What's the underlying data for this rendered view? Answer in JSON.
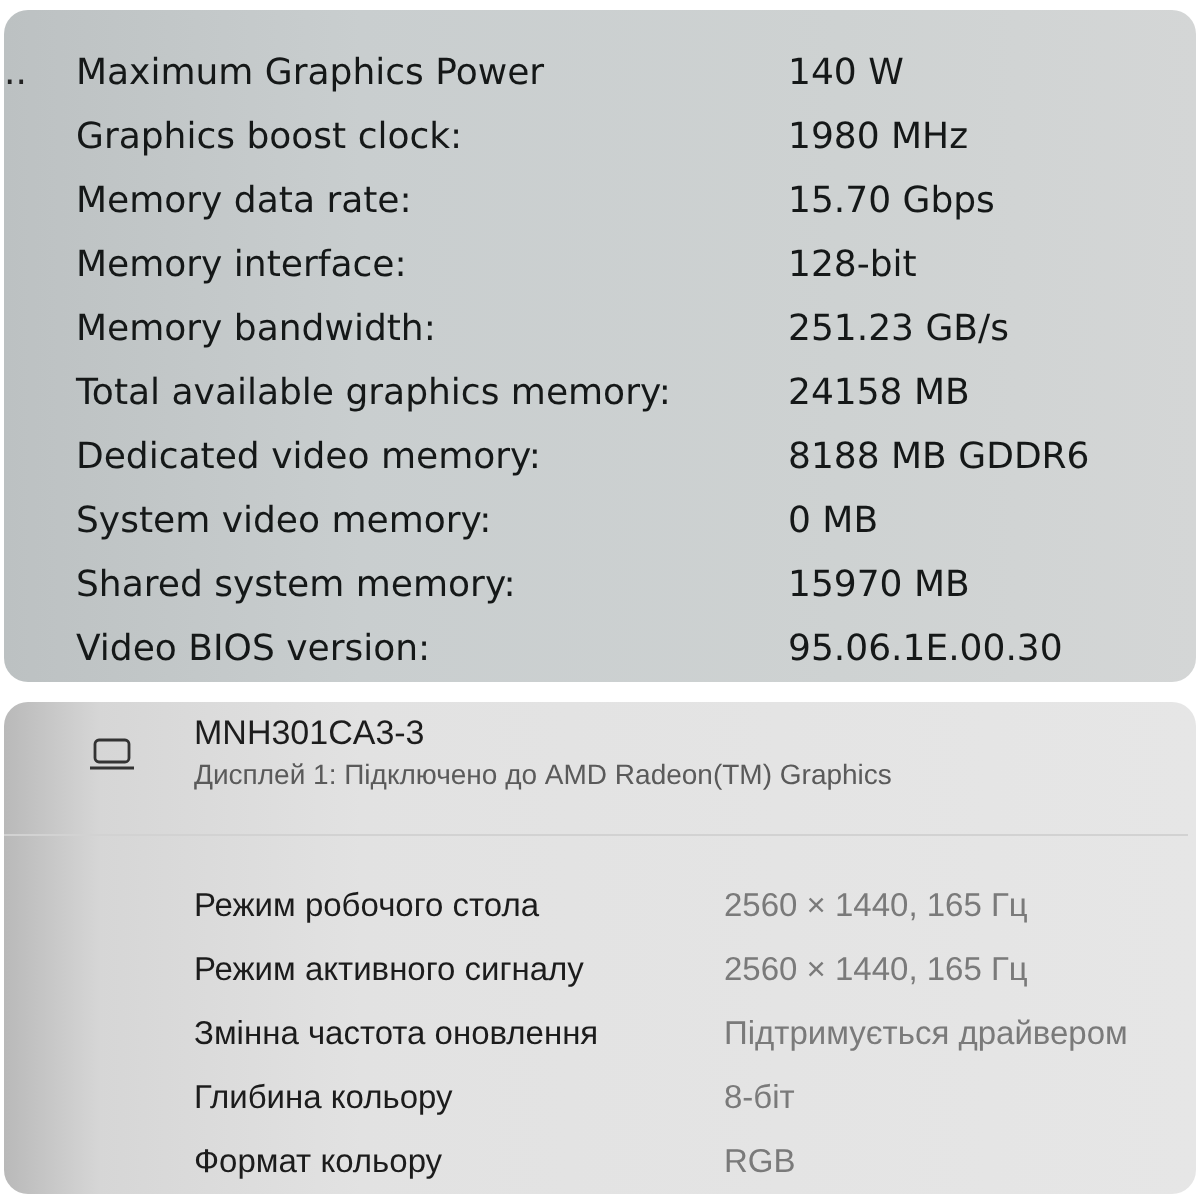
{
  "gpu_details": {
    "left_pane_fragment": "..",
    "properties": [
      {
        "label": "Maximum Graphics Power",
        "value": "140 W"
      },
      {
        "label": "Graphics boost clock:",
        "value": "1980 MHz"
      },
      {
        "label": "Memory data rate:",
        "value": "15.70 Gbps"
      },
      {
        "label": "Memory interface:",
        "value": "128-bit"
      },
      {
        "label": "Memory bandwidth:",
        "value": "251.23 GB/s"
      },
      {
        "label": "Total available graphics memory:",
        "value": "24158 MB"
      },
      {
        "label": "Dedicated video memory:",
        "value": "8188 MB GDDR6"
      },
      {
        "label": "System video memory:",
        "value": "0 MB"
      },
      {
        "label": "Shared system memory:",
        "value": "15970 MB"
      },
      {
        "label": "Video BIOS version:",
        "value": "95.06.1E.00.30"
      }
    ]
  },
  "display": {
    "name": "MNH301CA3-3",
    "connection": "Дисплей 1: Підключено до AMD Radeon(TM) Graphics",
    "properties": [
      {
        "label": "Режим робочого стола",
        "value": "2560 × 1440, 165 Гц"
      },
      {
        "label": "Режим активного сигналу",
        "value": "2560 × 1440, 165 Гц"
      },
      {
        "label": "Змінна частота оновлення",
        "value": "Підтримується драйвером"
      },
      {
        "label": "Глибина кольору",
        "value": "8-біт"
      },
      {
        "label": "Формат кольору",
        "value": "RGB"
      }
    ]
  }
}
